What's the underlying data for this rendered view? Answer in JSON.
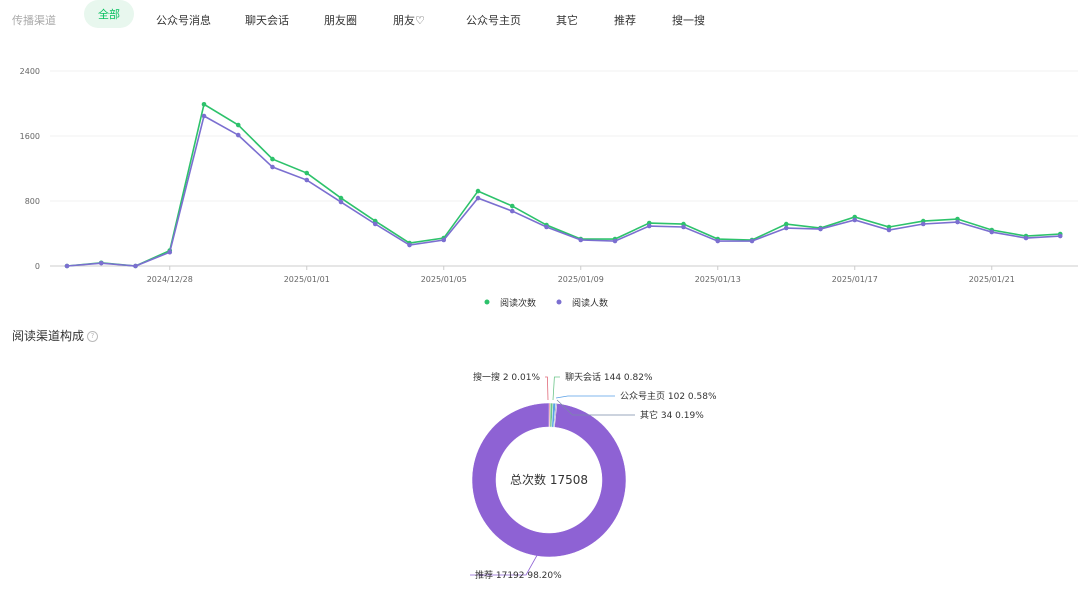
{
  "filter": {
    "label": "传播渠道",
    "tabs": [
      "全部",
      "公众号消息",
      "聊天会话",
      "朋友圈",
      "朋友♡",
      "公众号主页",
      "其它",
      "推荐",
      "搜一搜"
    ],
    "active": 0
  },
  "colors": {
    "green": "#2dc26b",
    "purple": "#7b6fd0",
    "donut": "#8e62d4"
  },
  "chart_data": [
    {
      "type": "line",
      "title": "",
      "ylim": [
        0,
        2400
      ],
      "yticks": [
        "0",
        "800",
        "1600",
        "2400"
      ],
      "xticks": [
        "2024/12/28",
        "2025/01/01",
        "2025/01/05",
        "2025/01/09",
        "2025/01/13",
        "2025/01/17",
        "2025/01/21"
      ],
      "x_start": "2024/12/25",
      "x_end": "2025/01/23",
      "series": [
        {
          "name": "阅读次数",
          "color": "#2dc26b",
          "values": [
            0,
            40,
            0,
            190,
            1990,
            1735,
            1316,
            1144,
            836,
            553,
            283,
            344,
            922,
            738,
            504,
            332,
            332,
            529,
            516,
            332,
            320,
            516,
            467,
            603,
            480,
            553,
            578,
            443,
            369,
            394
          ]
        },
        {
          "name": "阅读人数",
          "color": "#7b6fd0",
          "values": [
            0,
            35,
            0,
            170,
            1846,
            1611,
            1218,
            1058,
            787,
            517,
            258,
            320,
            836,
            676,
            480,
            320,
            307,
            492,
            480,
            307,
            307,
            467,
            455,
            566,
            443,
            517,
            541,
            418,
            344,
            369
          ]
        }
      ],
      "legend": "bottom"
    },
    {
      "type": "pie",
      "title": "阅读渠道构成",
      "center_label": "总次数 17508",
      "slices": [
        {
          "name": "聊天会话",
          "value": 144,
          "pct": "0.82%",
          "color": "#6cc58a"
        },
        {
          "name": "公众号主页",
          "value": 102,
          "pct": "0.58%",
          "color": "#5aa0e6"
        },
        {
          "name": "其它",
          "value": 34,
          "pct": "0.19%",
          "color": "#7a8aa8"
        },
        {
          "name": "推荐",
          "value": 17192,
          "pct": "98.20%",
          "color": "#8e62d4"
        },
        {
          "name": "搜一搜",
          "value": 2,
          "pct": "0.01%",
          "color": "#e06a7a"
        }
      ]
    }
  ]
}
